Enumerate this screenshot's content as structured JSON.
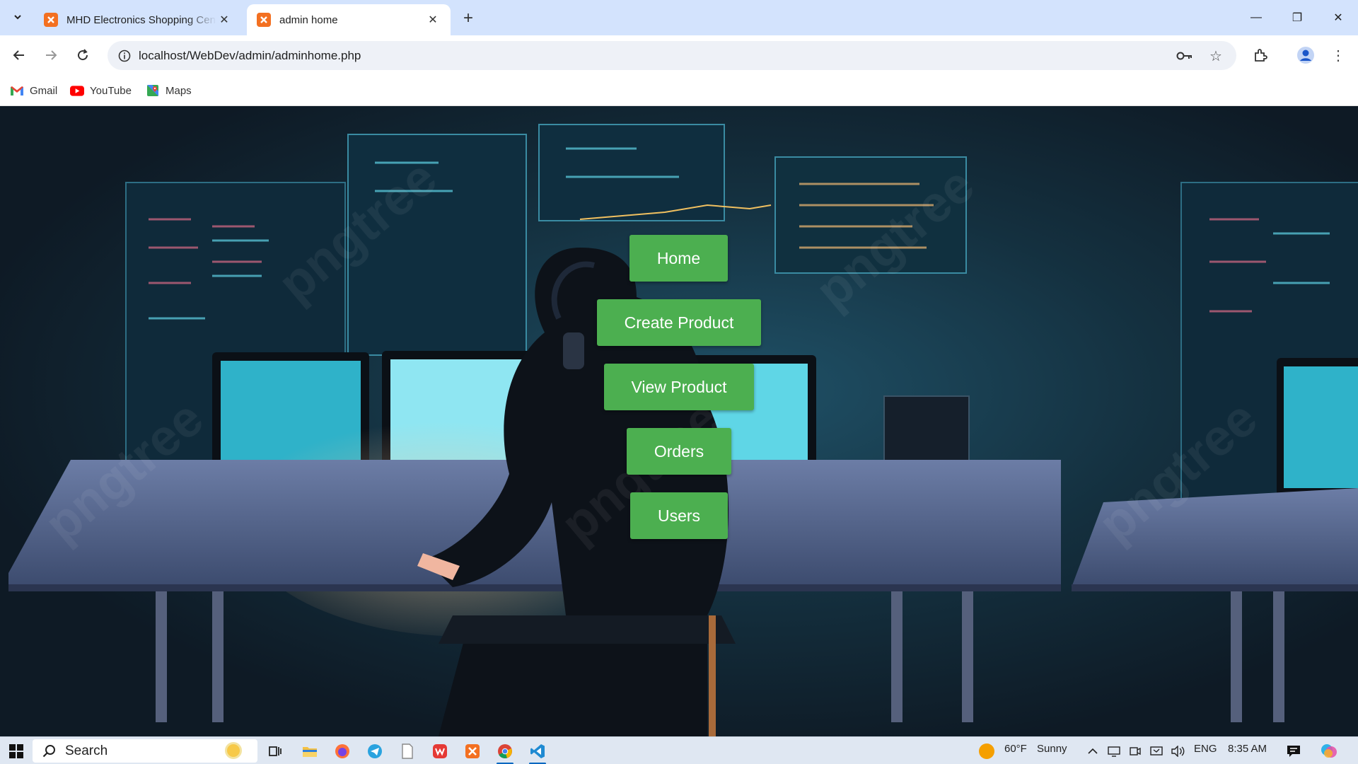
{
  "browser": {
    "tabs": [
      {
        "title": "MHD Electronics Shopping Cen",
        "active": false,
        "close": "✕"
      },
      {
        "title": "admin home",
        "active": true,
        "close": "✕"
      }
    ],
    "new_tab": "+",
    "url": "localhost/WebDev/admin/adminhome.php",
    "window_controls": {
      "minimize": "—",
      "restore": "❐",
      "close": "✕"
    },
    "bookmarks": [
      {
        "label": "Gmail",
        "icon": "gmail-icon"
      },
      {
        "label": "YouTube",
        "icon": "youtube-icon"
      },
      {
        "label": "Maps",
        "icon": "maps-icon"
      }
    ]
  },
  "admin_menu": {
    "buttons": [
      {
        "label": "Home"
      },
      {
        "label": "Create Product"
      },
      {
        "label": "View Product"
      },
      {
        "label": "Orders"
      },
      {
        "label": "Users"
      }
    ],
    "button_color": "#4caf50"
  },
  "background": {
    "watermark": "pngtree"
  },
  "taskbar": {
    "search_label": "Search",
    "weather": {
      "temp": "60°F",
      "condition": "Sunny"
    },
    "language": "ENG",
    "time": "8:35 AM"
  }
}
